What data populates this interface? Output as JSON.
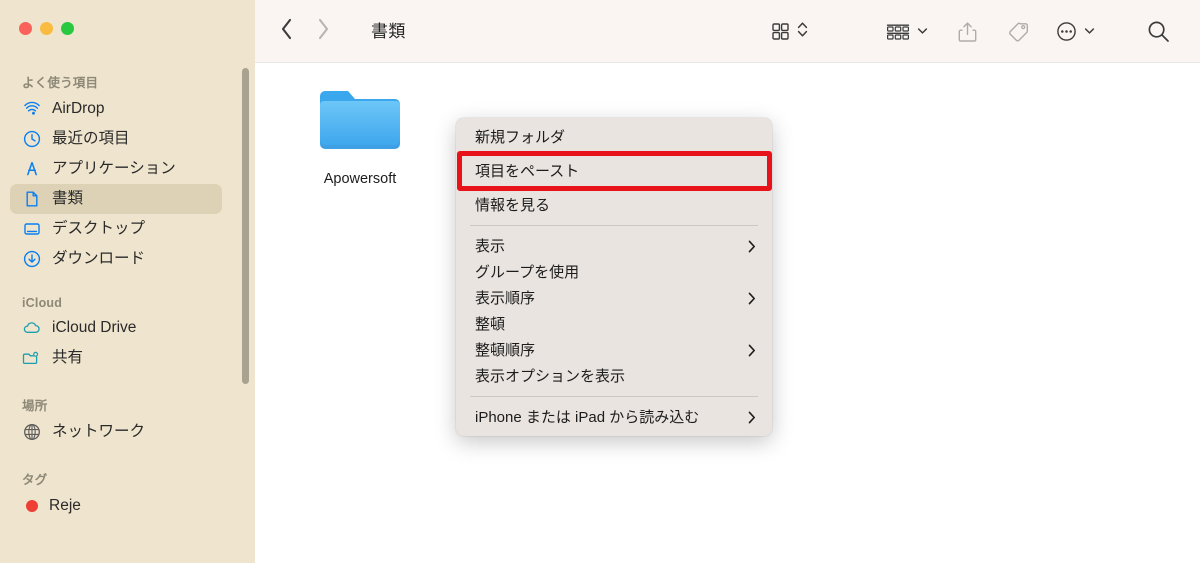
{
  "window": {
    "traffic_lights": [
      {
        "name": "close",
        "color": "#f9625a"
      },
      {
        "name": "minimize",
        "color": "#f9bc40"
      },
      {
        "name": "maximize",
        "color": "#28c840"
      }
    ]
  },
  "toolbar": {
    "back_icon": "chevron-left-icon",
    "forward_icon": "chevron-right-icon",
    "title": "書類",
    "view_icon": "grid-view-icon",
    "view_sort_icon": "chevron-up-down-icon",
    "group_icon": "group-by-icon",
    "group_chevron_icon": "chevron-down-icon",
    "share_icon": "share-icon",
    "tag_icon": "tag-icon",
    "more_icon": "ellipsis-circle-icon",
    "more_chevron_icon": "chevron-down-icon",
    "search_icon": "search-icon"
  },
  "sidebar": {
    "sections": [
      {
        "title": "よく使う項目",
        "items": [
          {
            "label": "AirDrop",
            "icon": "airdrop-icon",
            "selected": false
          },
          {
            "label": "最近の項目",
            "icon": "clock-icon",
            "selected": false
          },
          {
            "label": "アプリケーション",
            "icon": "applications-icon",
            "selected": false
          },
          {
            "label": "書類",
            "icon": "document-icon",
            "selected": true
          },
          {
            "label": "デスクトップ",
            "icon": "desktop-icon",
            "selected": false
          },
          {
            "label": "ダウンロード",
            "icon": "download-icon",
            "selected": false
          }
        ]
      },
      {
        "title": "iCloud",
        "items": [
          {
            "label": "iCloud Drive",
            "icon": "cloud-icon",
            "selected": false
          },
          {
            "label": "共有",
            "icon": "shared-folder-icon",
            "selected": false
          }
        ]
      },
      {
        "title": "場所",
        "items": [
          {
            "label": "ネットワーク",
            "icon": "globe-icon",
            "selected": false
          }
        ]
      },
      {
        "title": "タグ",
        "items": [
          {
            "label": "Reje",
            "icon": "red-tag-dot-icon",
            "selected": false
          }
        ]
      }
    ]
  },
  "content": {
    "files": [
      {
        "name": "Apowersoft",
        "icon": "folder-icon",
        "color": "#4db2f0"
      }
    ]
  },
  "context_menu": {
    "groups": [
      [
        {
          "label": "新規フォルダ",
          "submenu": false,
          "highlighted": false
        }
      ],
      [
        {
          "label": "項目をペースト",
          "submenu": false,
          "highlighted": true
        }
      ],
      [
        {
          "label": "情報を見る",
          "submenu": false,
          "highlighted": false
        }
      ],
      [
        {
          "label": "表示",
          "submenu": true,
          "highlighted": false
        },
        {
          "label": "グループを使用",
          "submenu": false,
          "highlighted": false
        },
        {
          "label": "表示順序",
          "submenu": true,
          "highlighted": false
        },
        {
          "label": "整頓",
          "submenu": false,
          "highlighted": false
        },
        {
          "label": "整頓順序",
          "submenu": true,
          "highlighted": false
        },
        {
          "label": "表示オプションを表示",
          "submenu": false,
          "highlighted": false
        }
      ],
      [
        {
          "label": "iPhone または iPad から読み込む",
          "submenu": true,
          "highlighted": false
        }
      ]
    ],
    "highlight_color": "#e8131a"
  }
}
